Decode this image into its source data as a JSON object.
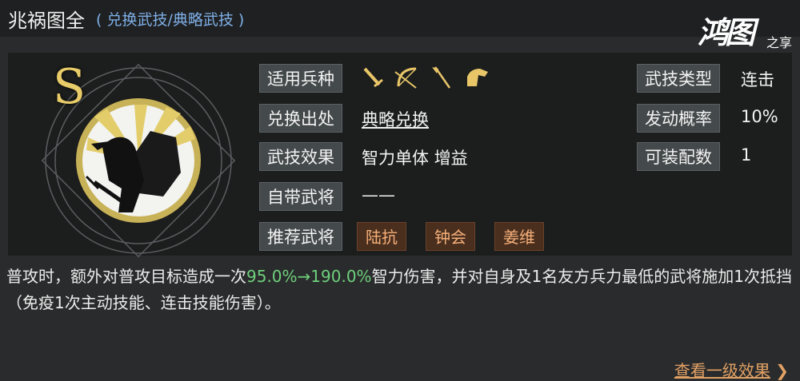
{
  "header": {
    "title": "兆祸图全",
    "subtitle": "( 兑换武技/典略武技 )"
  },
  "logo": {
    "text": "鸿图",
    "sub": "之享"
  },
  "emblem": {
    "grade": "S"
  },
  "rows": {
    "unit_type": {
      "label": "适用兵种",
      "icons": [
        "sword-icon",
        "bow-icon",
        "spear-icon",
        "horse-icon"
      ]
    },
    "source": {
      "label": "兑换出处",
      "value": "典略兑换"
    },
    "effect": {
      "label": "武技效果",
      "value": "智力单体 增益"
    },
    "own_general": {
      "label": "自带武将",
      "value": "——"
    },
    "recommended": {
      "label": "推荐武将",
      "generals": [
        "陆抗",
        "钟会",
        "姜维"
      ]
    },
    "skill_type": {
      "label": "武技类型",
      "value": "连击"
    },
    "trigger_rate": {
      "label": "发动概率",
      "value": "10%"
    },
    "equip_count": {
      "label": "可装配数",
      "value": "1"
    }
  },
  "description": {
    "p1": "普攻时，额外对普攻目标造成一次",
    "highlight": "95.0%→190.0%",
    "p2": "智力伤害，并对自身及1名友方兵力最低的武将施加1次抵挡（免疫1次主动技能、连击技能伤害）。"
  },
  "footer": {
    "link": "查看一级效果",
    "arrow": "❯"
  },
  "colors": {
    "highlight": "#6ed07c",
    "general_text": "#f6b07a",
    "subtitle": "#7fb0e8"
  }
}
